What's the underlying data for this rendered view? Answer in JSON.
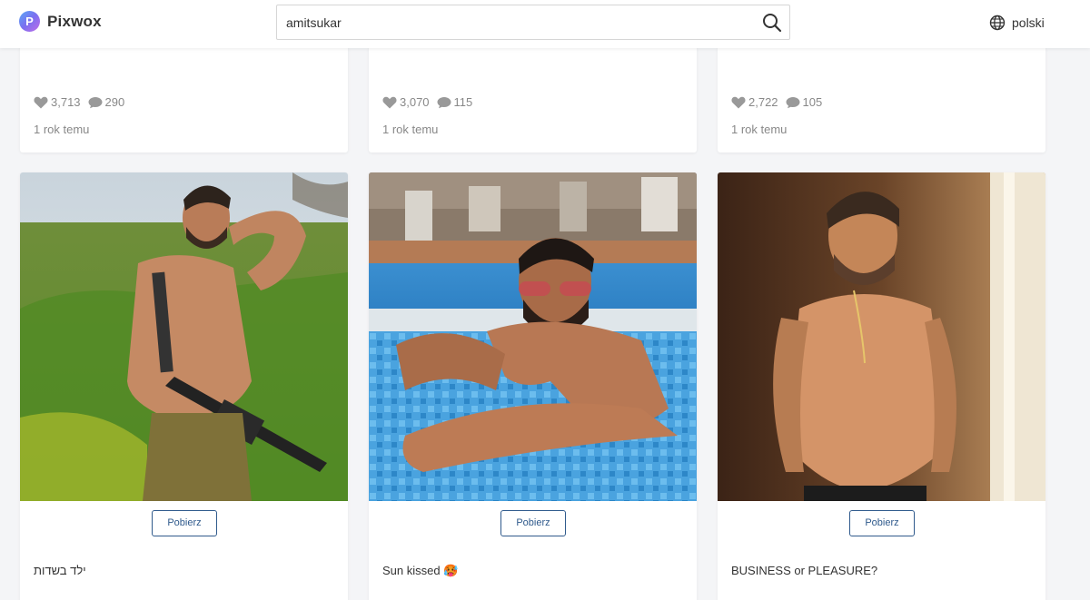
{
  "header": {
    "logo_letter": "P",
    "logo_text": "Pixwox",
    "search": {
      "value": "amitsukar",
      "icon": "search-icon"
    },
    "language": {
      "label": "polski",
      "icon": "globe-icon"
    }
  },
  "top_cards": [
    {
      "likes": "3,713",
      "comments": "290",
      "time": "1 rok temu"
    },
    {
      "likes": "3,070",
      "comments": "115",
      "time": "1 rok temu"
    },
    {
      "likes": "2,722",
      "comments": "105",
      "time": "1 rok temu"
    }
  ],
  "posts": [
    {
      "button": "Pobierz",
      "caption": "ילד בשדות"
    },
    {
      "button": "Pobierz",
      "caption": "Sun kissed 🥵"
    },
    {
      "button": "Pobierz",
      "caption": "BUSINESS or PLEASURE?"
    }
  ],
  "colors": {
    "brand": "#7b6ff0",
    "button_border": "#2f5a8c",
    "muted": "#888888"
  }
}
